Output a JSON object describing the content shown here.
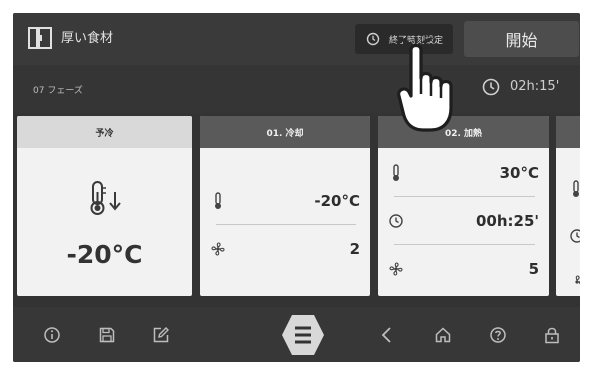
{
  "header": {
    "title": "厚い食材",
    "end_time_label": "終了時刻設定",
    "start_label": "開始"
  },
  "phase_bar": {
    "phase_label": "07 フェーズ",
    "total_time": "02h:15'"
  },
  "cards": [
    {
      "title": "予冷",
      "temperature": "-20°C",
      "icon": "probe-thermometer-down-icon"
    },
    {
      "title": "01. 冷却",
      "temperature": "-20°C",
      "fan_speed": "2"
    },
    {
      "title": "02. 加熱",
      "temperature": "30°C",
      "duration": "00h:25'",
      "fan_speed": "5"
    }
  ],
  "footer": {
    "icons": [
      "info-icon",
      "save-icon",
      "edit-icon",
      "menu-icon",
      "back-icon",
      "home-icon",
      "help-icon",
      "lock-icon"
    ]
  },
  "colors": {
    "screen_bg": "#333333",
    "card_bg": "#f2f2f2",
    "card_head_active": "#5a5a5a",
    "card_head_first": "#d9d9d9",
    "menu_hex": "#d8d8d8"
  }
}
